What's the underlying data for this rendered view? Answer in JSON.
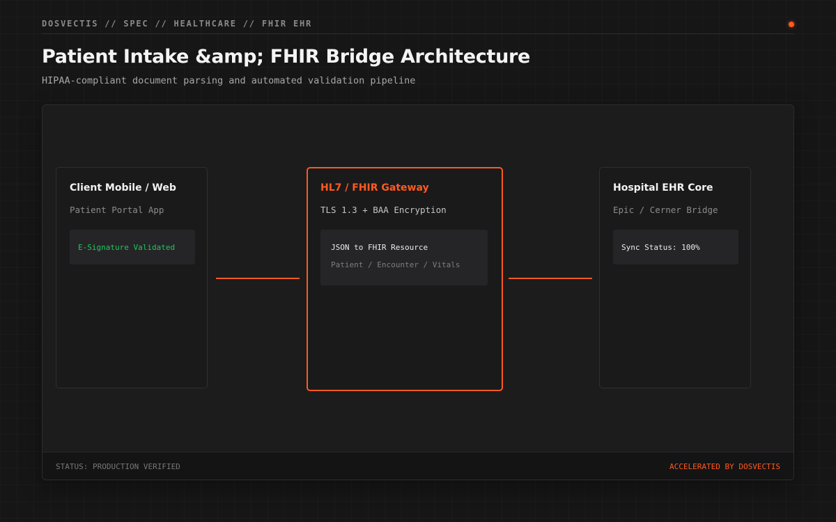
{
  "header": {
    "breadcrumb": "DOSVECTIS // SPEC // HEALTHCARE // FHIR EHR",
    "title": "Patient Intake &amp; FHIR Bridge Architecture",
    "subtitle": "HIPAA-compliant document parsing and automated validation pipeline"
  },
  "diagram": {
    "nodes": [
      {
        "title": "Client Mobile / Web",
        "subtitle": "Patient Portal App",
        "box": {
          "line1": "E-Signature Validated"
        }
      },
      {
        "title": "HL7 / FHIR Gateway",
        "subtitle": "TLS 1.3 + BAA Encryption",
        "box": {
          "line1": "JSON to FHIR Resource",
          "line2": "Patient / Encounter / Vitals"
        }
      },
      {
        "title": "Hospital EHR Core",
        "subtitle": "Epic / Cerner Bridge",
        "box": {
          "line1": "Sync Status: 100%"
        }
      }
    ],
    "edges": [
      {
        "from": "Client Mobile / Web",
        "to": "HL7 / FHIR Gateway"
      },
      {
        "from": "HL7 / FHIR Gateway",
        "to": "Hospital EHR Core"
      }
    ]
  },
  "footer": {
    "status": "STATUS: PRODUCTION VERIFIED",
    "credit": "ACCELERATED BY DOSVECTIS"
  },
  "colors": {
    "accent": "#ff5a1f",
    "success": "#22c55e",
    "background": "#161616",
    "panel": "#1c1c1d"
  }
}
